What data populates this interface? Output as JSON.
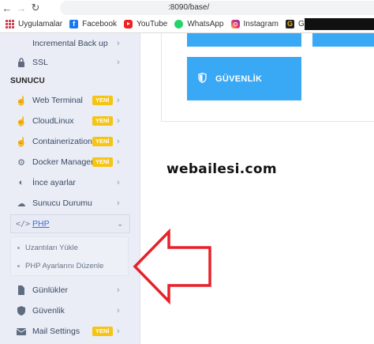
{
  "browser": {
    "url": ":8090/base/",
    "bookmarks": [
      {
        "label": "Uygulamalar",
        "icon": "apps-grid-icon"
      },
      {
        "label": "Facebook",
        "icon": "facebook-icon"
      },
      {
        "label": "YouTube",
        "icon": "youtube-icon"
      },
      {
        "label": "WhatsApp",
        "icon": "whatsapp-icon"
      },
      {
        "label": "Instagram",
        "icon": "instagram-icon"
      },
      {
        "label": "GT TR",
        "icon": "gt-icon"
      }
    ]
  },
  "sidebar": {
    "items_top": [
      {
        "label": "Incremental Back up",
        "icon": "backup-icon"
      },
      {
        "label": "SSL",
        "icon": "lock-icon"
      }
    ],
    "section_title": "SUNUCU",
    "items": [
      {
        "label": "Web Terminal",
        "badge": "YENİ",
        "icon": "hand-pointer-icon"
      },
      {
        "label": "CloudLinux",
        "badge": "YENİ",
        "icon": "hand-pointer-icon"
      },
      {
        "label": "Containerization",
        "badge": "YENİ",
        "icon": "hand-pointer-icon"
      },
      {
        "label": "Docker Manager",
        "badge": "YENİ",
        "icon": "cogs-icon"
      },
      {
        "label": "İnce ayarlar",
        "icon": "adjust-icon"
      },
      {
        "label": "Sunucu Durumu",
        "icon": "cloud-icon"
      }
    ],
    "php": {
      "label": "PHP",
      "icon": "code-icon"
    },
    "php_submenu": [
      {
        "label": "Uzantıları Yükle"
      },
      {
        "label": "PHP Ayarlarını Düzenle"
      }
    ],
    "items_bottom": [
      {
        "label": "Günlükler",
        "icon": "file-icon"
      },
      {
        "label": "Güvenlik",
        "icon": "shield-icon"
      },
      {
        "label": "Mail Settings",
        "badge": "YENİ",
        "icon": "envelope-icon"
      }
    ]
  },
  "main": {
    "security_button": "GÜVENLİK"
  },
  "watermark": "webailesi.com",
  "colors": {
    "tile_blue": "#39a8f5",
    "badge_yellow": "#f6c414",
    "sidebar_bg": "#eaedf6",
    "arrow_red": "#e8202a"
  }
}
